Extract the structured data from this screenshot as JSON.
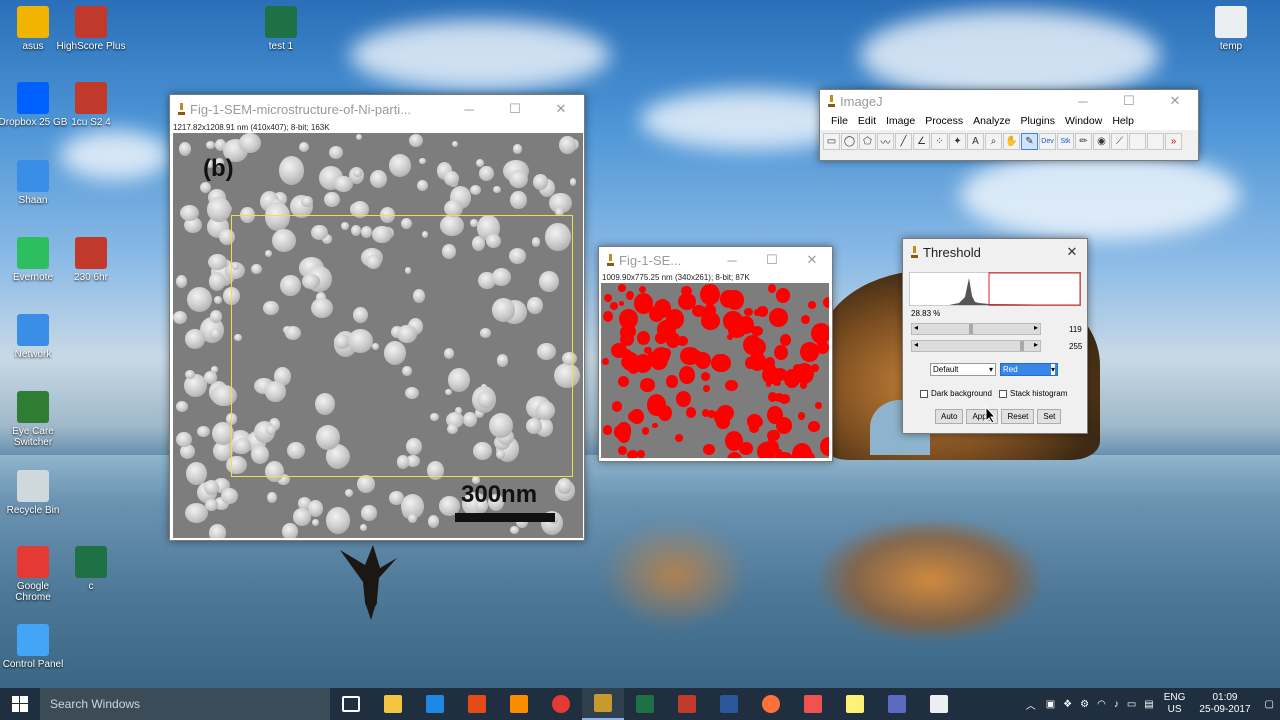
{
  "desktop_icons": [
    {
      "label": "asus",
      "color": "#f1b400"
    },
    {
      "label": "HighScore Plus",
      "color": "#c0392b"
    },
    {
      "label": "test 1",
      "color": "#1e7145"
    },
    {
      "label": "Dropbox 25 GB",
      "color": "#0061fe"
    },
    {
      "label": "1cu S2 4",
      "color": "#c0392b"
    },
    {
      "label": "Shaan",
      "color": "#3a8ee6"
    },
    {
      "label": "Evernote",
      "color": "#2dbe60"
    },
    {
      "label": "230 6hr",
      "color": "#c0392b"
    },
    {
      "label": "Network",
      "color": "#3a8ee6"
    },
    {
      "label": "Eye Care Switcher",
      "color": "#2e7d32"
    },
    {
      "label": "Recycle Bin",
      "color": "#cfd8dc"
    },
    {
      "label": "Google Chrome",
      "color": "#e53935"
    },
    {
      "label": "c",
      "color": "#1e7145"
    },
    {
      "label": "Control Panel",
      "color": "#42a5f5"
    },
    {
      "label": "temp",
      "color": "#eceff1"
    }
  ],
  "sem_window": {
    "title": "Fig-1-SEM-microstructure-of-Ni-parti...",
    "info": "1217.82x1208.91 nm (410x407); 8-bit; 163K",
    "panel_label": "(b)",
    "scale_label": "300nm"
  },
  "mask_window": {
    "title": "Fig-1-SE...",
    "info": "1009.90x775.25 nm (340x261); 8-bit; 87K"
  },
  "imagej": {
    "title": "ImageJ",
    "menu": [
      "File",
      "Edit",
      "Image",
      "Process",
      "Analyze",
      "Plugins",
      "Window",
      "Help"
    ],
    "tools": [
      "rect-icon",
      "oval-icon",
      "polygon-icon",
      "freehand-icon",
      "line-icon",
      "angle-icon",
      "point-icon",
      "wand-icon",
      "text-icon",
      "zoom-icon",
      "hand-icon",
      "dropper-icon",
      "dev-icon",
      "stk-icon",
      "pencil-icon",
      "fill-icon",
      "brush-icon",
      "blank-icon",
      "blank-icon-2",
      "more-icon"
    ],
    "tool_labels": {
      "dev": "Dev",
      "stk": "Stk",
      "more": "»",
      "text": "A"
    }
  },
  "threshold": {
    "title": "Threshold",
    "percent": "28.83 %",
    "min_value": "119",
    "max_value": "255",
    "slider1_fraction": 0.467,
    "slider2_fraction": 1.0,
    "method": "Default",
    "display": "Red",
    "dark_background_label": "Dark background",
    "stack_histogram_label": "Stack histogram",
    "buttons": [
      "Auto",
      "Apply",
      "Reset",
      "Set"
    ]
  },
  "taskbar": {
    "search_placeholder": "Search Windows",
    "apps": [
      {
        "name": "task-view-icon",
        "color": "#ffffff"
      },
      {
        "name": "file-explorer-icon",
        "color": "#f4c542"
      },
      {
        "name": "edge-icon",
        "color": "#1e88e5"
      },
      {
        "name": "office-icon",
        "color": "#e64a19"
      },
      {
        "name": "orange-app-icon",
        "color": "#fb8c00"
      },
      {
        "name": "chrome-icon",
        "color": "#e53935"
      },
      {
        "name": "imagej-icon",
        "color": "#c79a2f"
      },
      {
        "name": "excel-icon",
        "color": "#1e7145"
      },
      {
        "name": "highscore-icon",
        "color": "#c0392b"
      },
      {
        "name": "word-icon",
        "color": "#2b579a"
      },
      {
        "name": "firefox-icon",
        "color": "#ff7139"
      },
      {
        "name": "paint-icon",
        "color": "#ef5350"
      },
      {
        "name": "folder-icon",
        "color": "#fff176"
      },
      {
        "name": "onenote-icon",
        "color": "#5c6bc0"
      },
      {
        "name": "window-icon",
        "color": "#eceff1"
      }
    ],
    "lang_top": "ENG",
    "lang_bottom": "US",
    "time": "01:09",
    "date": "25-09-2017"
  }
}
